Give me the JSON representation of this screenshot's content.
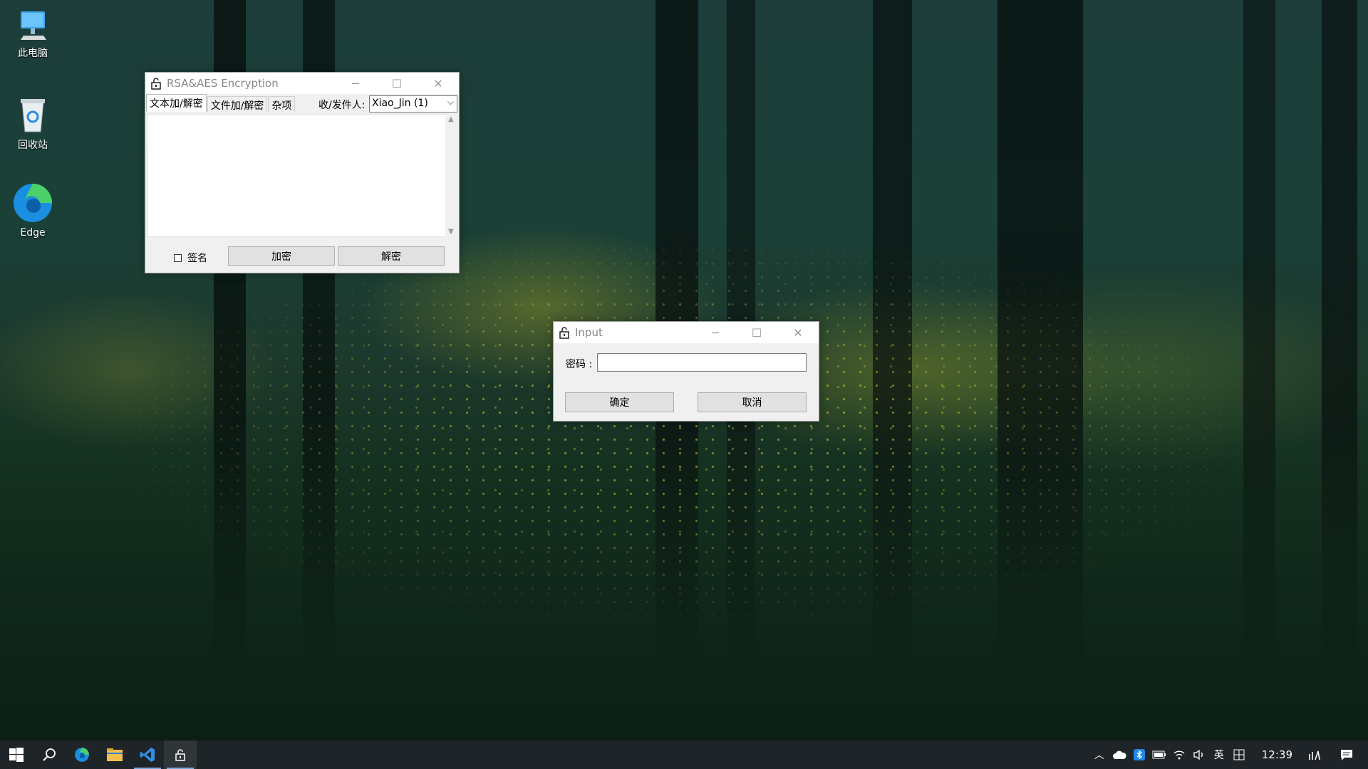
{
  "desktop": {
    "icons": [
      {
        "label": "此电脑",
        "icon": "this-pc-icon"
      },
      {
        "label": "回收站",
        "icon": "recycle-bin-icon"
      },
      {
        "label": "Edge",
        "icon": "edge-icon"
      }
    ]
  },
  "main_window": {
    "title": "RSA&AES Encryption",
    "tabs": [
      "文本加/解密",
      "文件加/解密",
      "杂项"
    ],
    "active_tab": "文本加/解密",
    "recipient_label": "收/发件人:",
    "recipient_value": "Xiao_Jin (1)",
    "sign_label": "签名",
    "sign_checked": false,
    "encrypt_button": "加密",
    "decrypt_button": "解密"
  },
  "input_dialog": {
    "title": "Input",
    "password_label": "密码 :",
    "password_value": "",
    "ok_button": "确定",
    "cancel_button": "取消"
  },
  "taskbar": {
    "pinned": [
      "windows-start-icon",
      "search-icon",
      "edge-icon",
      "file-explorer-icon",
      "vscode-icon",
      "lock-app-icon"
    ],
    "tray": {
      "ime_label": "英",
      "clock": "12:39"
    }
  },
  "colors": {
    "taskbar": "#1f2428",
    "accent": "#7aa7d8"
  }
}
